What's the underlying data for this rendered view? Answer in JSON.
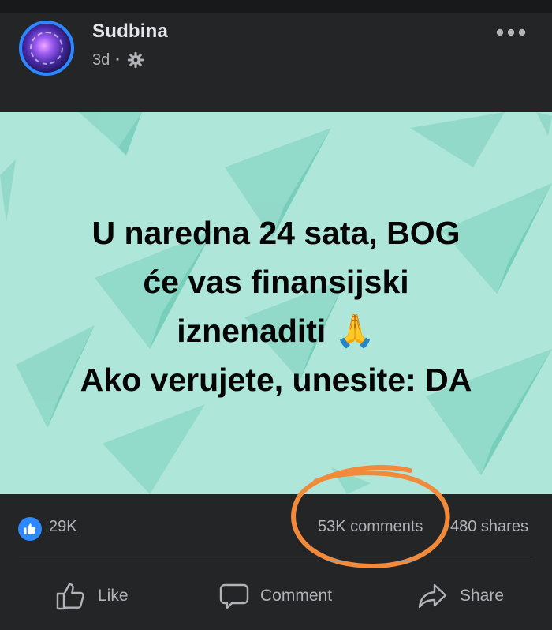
{
  "post": {
    "page_name": "Sudbina",
    "time": "3d",
    "separator": "·",
    "audience_icon": "gear-icon",
    "more_icon": "more-options-icon",
    "image_text": [
      "U naredna 24 sata, BOG",
      "će vas finansijski",
      "iznenaditi 🙏",
      "Ako verujete, unesite: DA"
    ]
  },
  "stats": {
    "likes": "29K",
    "comments": "53K comments",
    "shares": "480 shares"
  },
  "actions": {
    "like": "Like",
    "comment": "Comment",
    "share": "Share"
  },
  "colors": {
    "background": "#242526",
    "image_background": "#aee6da",
    "accent": "#2d88ff",
    "annotation": "#f28a3c",
    "secondary_text": "#b0b3b8"
  }
}
